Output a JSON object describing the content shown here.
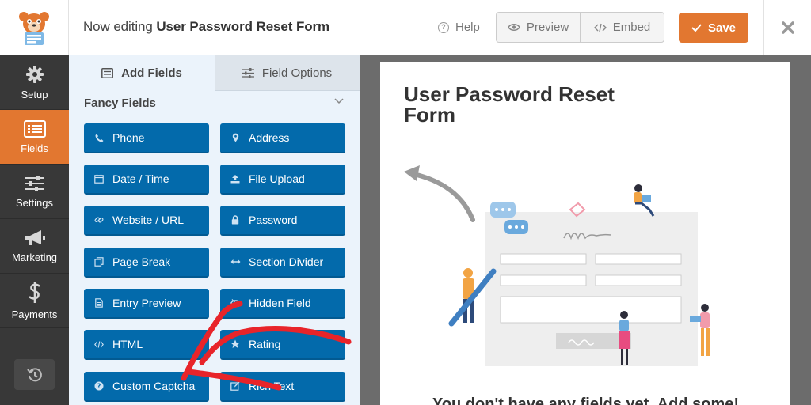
{
  "header": {
    "editing_prefix": "Now editing ",
    "form_name": "User Password Reset Form",
    "help_label": "Help",
    "preview_label": "Preview",
    "embed_label": "Embed",
    "save_label": "Save",
    "icons": {
      "logo": "wpforms-bear-logo",
      "help": "question-circle-icon",
      "preview": "eye-icon",
      "embed": "code-icon",
      "save": "check-icon",
      "close": "close-icon"
    }
  },
  "nav": {
    "items": [
      {
        "label": "Setup",
        "icon": "gear-icon",
        "active": false
      },
      {
        "label": "Fields",
        "icon": "list-icon",
        "active": true
      },
      {
        "label": "Settings",
        "icon": "sliders-icon",
        "active": false
      },
      {
        "label": "Marketing",
        "icon": "megaphone-icon",
        "active": false
      },
      {
        "label": "Payments",
        "icon": "dollar-icon",
        "active": false
      }
    ],
    "undo_icon": "history-icon"
  },
  "panel": {
    "tabs": [
      {
        "label": "Add Fields",
        "icon": "list-alt-icon",
        "active": true
      },
      {
        "label": "Field Options",
        "icon": "sliders-icon",
        "active": false
      }
    ],
    "section_title": "Fancy Fields",
    "fields": [
      {
        "label": "Phone",
        "icon": "phone-icon"
      },
      {
        "label": "Address",
        "icon": "map-marker-icon"
      },
      {
        "label": "Date / Time",
        "icon": "calendar-icon"
      },
      {
        "label": "File Upload",
        "icon": "upload-icon"
      },
      {
        "label": "Website / URL",
        "icon": "link-icon"
      },
      {
        "label": "Password",
        "icon": "lock-icon"
      },
      {
        "label": "Page Break",
        "icon": "copy-icon"
      },
      {
        "label": "Section Divider",
        "icon": "arrows-h-icon"
      },
      {
        "label": "Entry Preview",
        "icon": "file-text-icon"
      },
      {
        "label": "Hidden Field",
        "icon": "eye-slash-icon"
      },
      {
        "label": "HTML",
        "icon": "code-icon"
      },
      {
        "label": "Rating",
        "icon": "star-icon"
      },
      {
        "label": "Custom Captcha",
        "icon": "question-circle-icon"
      },
      {
        "label": "Rich Text",
        "icon": "edit-icon"
      }
    ]
  },
  "form": {
    "title": "User Password Reset Form",
    "empty_message": "You don't have any fields yet. Add some!"
  },
  "colors": {
    "accent": "#e27730",
    "field_button": "#036aab",
    "nav_bg": "#383838",
    "panel_bg": "#ebf3fb",
    "annotation": "#e8242a"
  }
}
